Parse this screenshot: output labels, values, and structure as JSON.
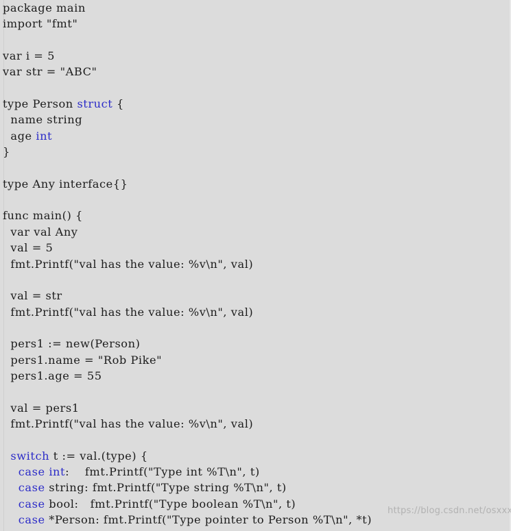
{
  "document": {
    "kind": "source-code-listing",
    "language": "Go",
    "background_color": "#dcdcdc",
    "text_color": "#1c1c1c",
    "keyword_color": "#2c2cc8"
  },
  "watermark": {
    "text": "https://blog.csdn.net/osxxxn"
  },
  "code": {
    "lines": [
      {
        "segments": [
          {
            "t": "package main"
          }
        ]
      },
      {
        "segments": [
          {
            "t": "import \"fmt\""
          }
        ]
      },
      {
        "segments": [
          {
            "t": ""
          }
        ]
      },
      {
        "segments": [
          {
            "t": "var i = 5"
          }
        ]
      },
      {
        "segments": [
          {
            "t": "var str = \"ABC\""
          }
        ]
      },
      {
        "segments": [
          {
            "t": ""
          }
        ]
      },
      {
        "segments": [
          {
            "t": "type Person "
          },
          {
            "t": "struct",
            "kw": true
          },
          {
            "t": " {"
          }
        ]
      },
      {
        "segments": [
          {
            "t": "  name string"
          }
        ]
      },
      {
        "segments": [
          {
            "t": "  age "
          },
          {
            "t": "int",
            "kw": true
          }
        ]
      },
      {
        "segments": [
          {
            "t": "}"
          }
        ]
      },
      {
        "segments": [
          {
            "t": ""
          }
        ]
      },
      {
        "segments": [
          {
            "t": "type Any interface{}"
          }
        ]
      },
      {
        "segments": [
          {
            "t": ""
          }
        ]
      },
      {
        "segments": [
          {
            "t": "func main() {"
          }
        ]
      },
      {
        "segments": [
          {
            "t": "  var val Any"
          }
        ]
      },
      {
        "segments": [
          {
            "t": "  val = 5"
          }
        ]
      },
      {
        "segments": [
          {
            "t": "  fmt.Printf(\"val has the value: %v\\n\", val)"
          }
        ]
      },
      {
        "segments": [
          {
            "t": ""
          }
        ]
      },
      {
        "segments": [
          {
            "t": "  val = str"
          }
        ]
      },
      {
        "segments": [
          {
            "t": "  fmt.Printf(\"val has the value: %v\\n\", val)"
          }
        ]
      },
      {
        "segments": [
          {
            "t": ""
          }
        ]
      },
      {
        "segments": [
          {
            "t": "  pers1 := new(Person)"
          }
        ]
      },
      {
        "segments": [
          {
            "t": "  pers1.name = \"Rob Pike\""
          }
        ]
      },
      {
        "segments": [
          {
            "t": "  pers1.age = 55"
          }
        ]
      },
      {
        "segments": [
          {
            "t": ""
          }
        ]
      },
      {
        "segments": [
          {
            "t": "  val = pers1"
          }
        ]
      },
      {
        "segments": [
          {
            "t": "  fmt.Printf(\"val has the value: %v\\n\", val)"
          }
        ]
      },
      {
        "segments": [
          {
            "t": ""
          }
        ]
      },
      {
        "segments": [
          {
            "t": "  "
          },
          {
            "t": "switch",
            "kw": true
          },
          {
            "t": " t := val.(type) {"
          }
        ]
      },
      {
        "segments": [
          {
            "t": "    "
          },
          {
            "t": "case",
            "kw": true
          },
          {
            "t": " "
          },
          {
            "t": "int",
            "kw": true
          },
          {
            "t": ":    fmt.Printf(\"Type int %T\\n\", t)"
          }
        ]
      },
      {
        "segments": [
          {
            "t": "    "
          },
          {
            "t": "case",
            "kw": true
          },
          {
            "t": " string: fmt.Printf(\"Type string %T\\n\", t)"
          }
        ]
      },
      {
        "segments": [
          {
            "t": "    "
          },
          {
            "t": "case",
            "kw": true
          },
          {
            "t": " bool:   fmt.Printf(\"Type boolean %T\\n\", t)"
          }
        ]
      },
      {
        "segments": [
          {
            "t": "    "
          },
          {
            "t": "case",
            "kw": true
          },
          {
            "t": " *Person: fmt.Printf(\"Type pointer to Person %T\\n\", *t)"
          }
        ]
      }
    ]
  }
}
